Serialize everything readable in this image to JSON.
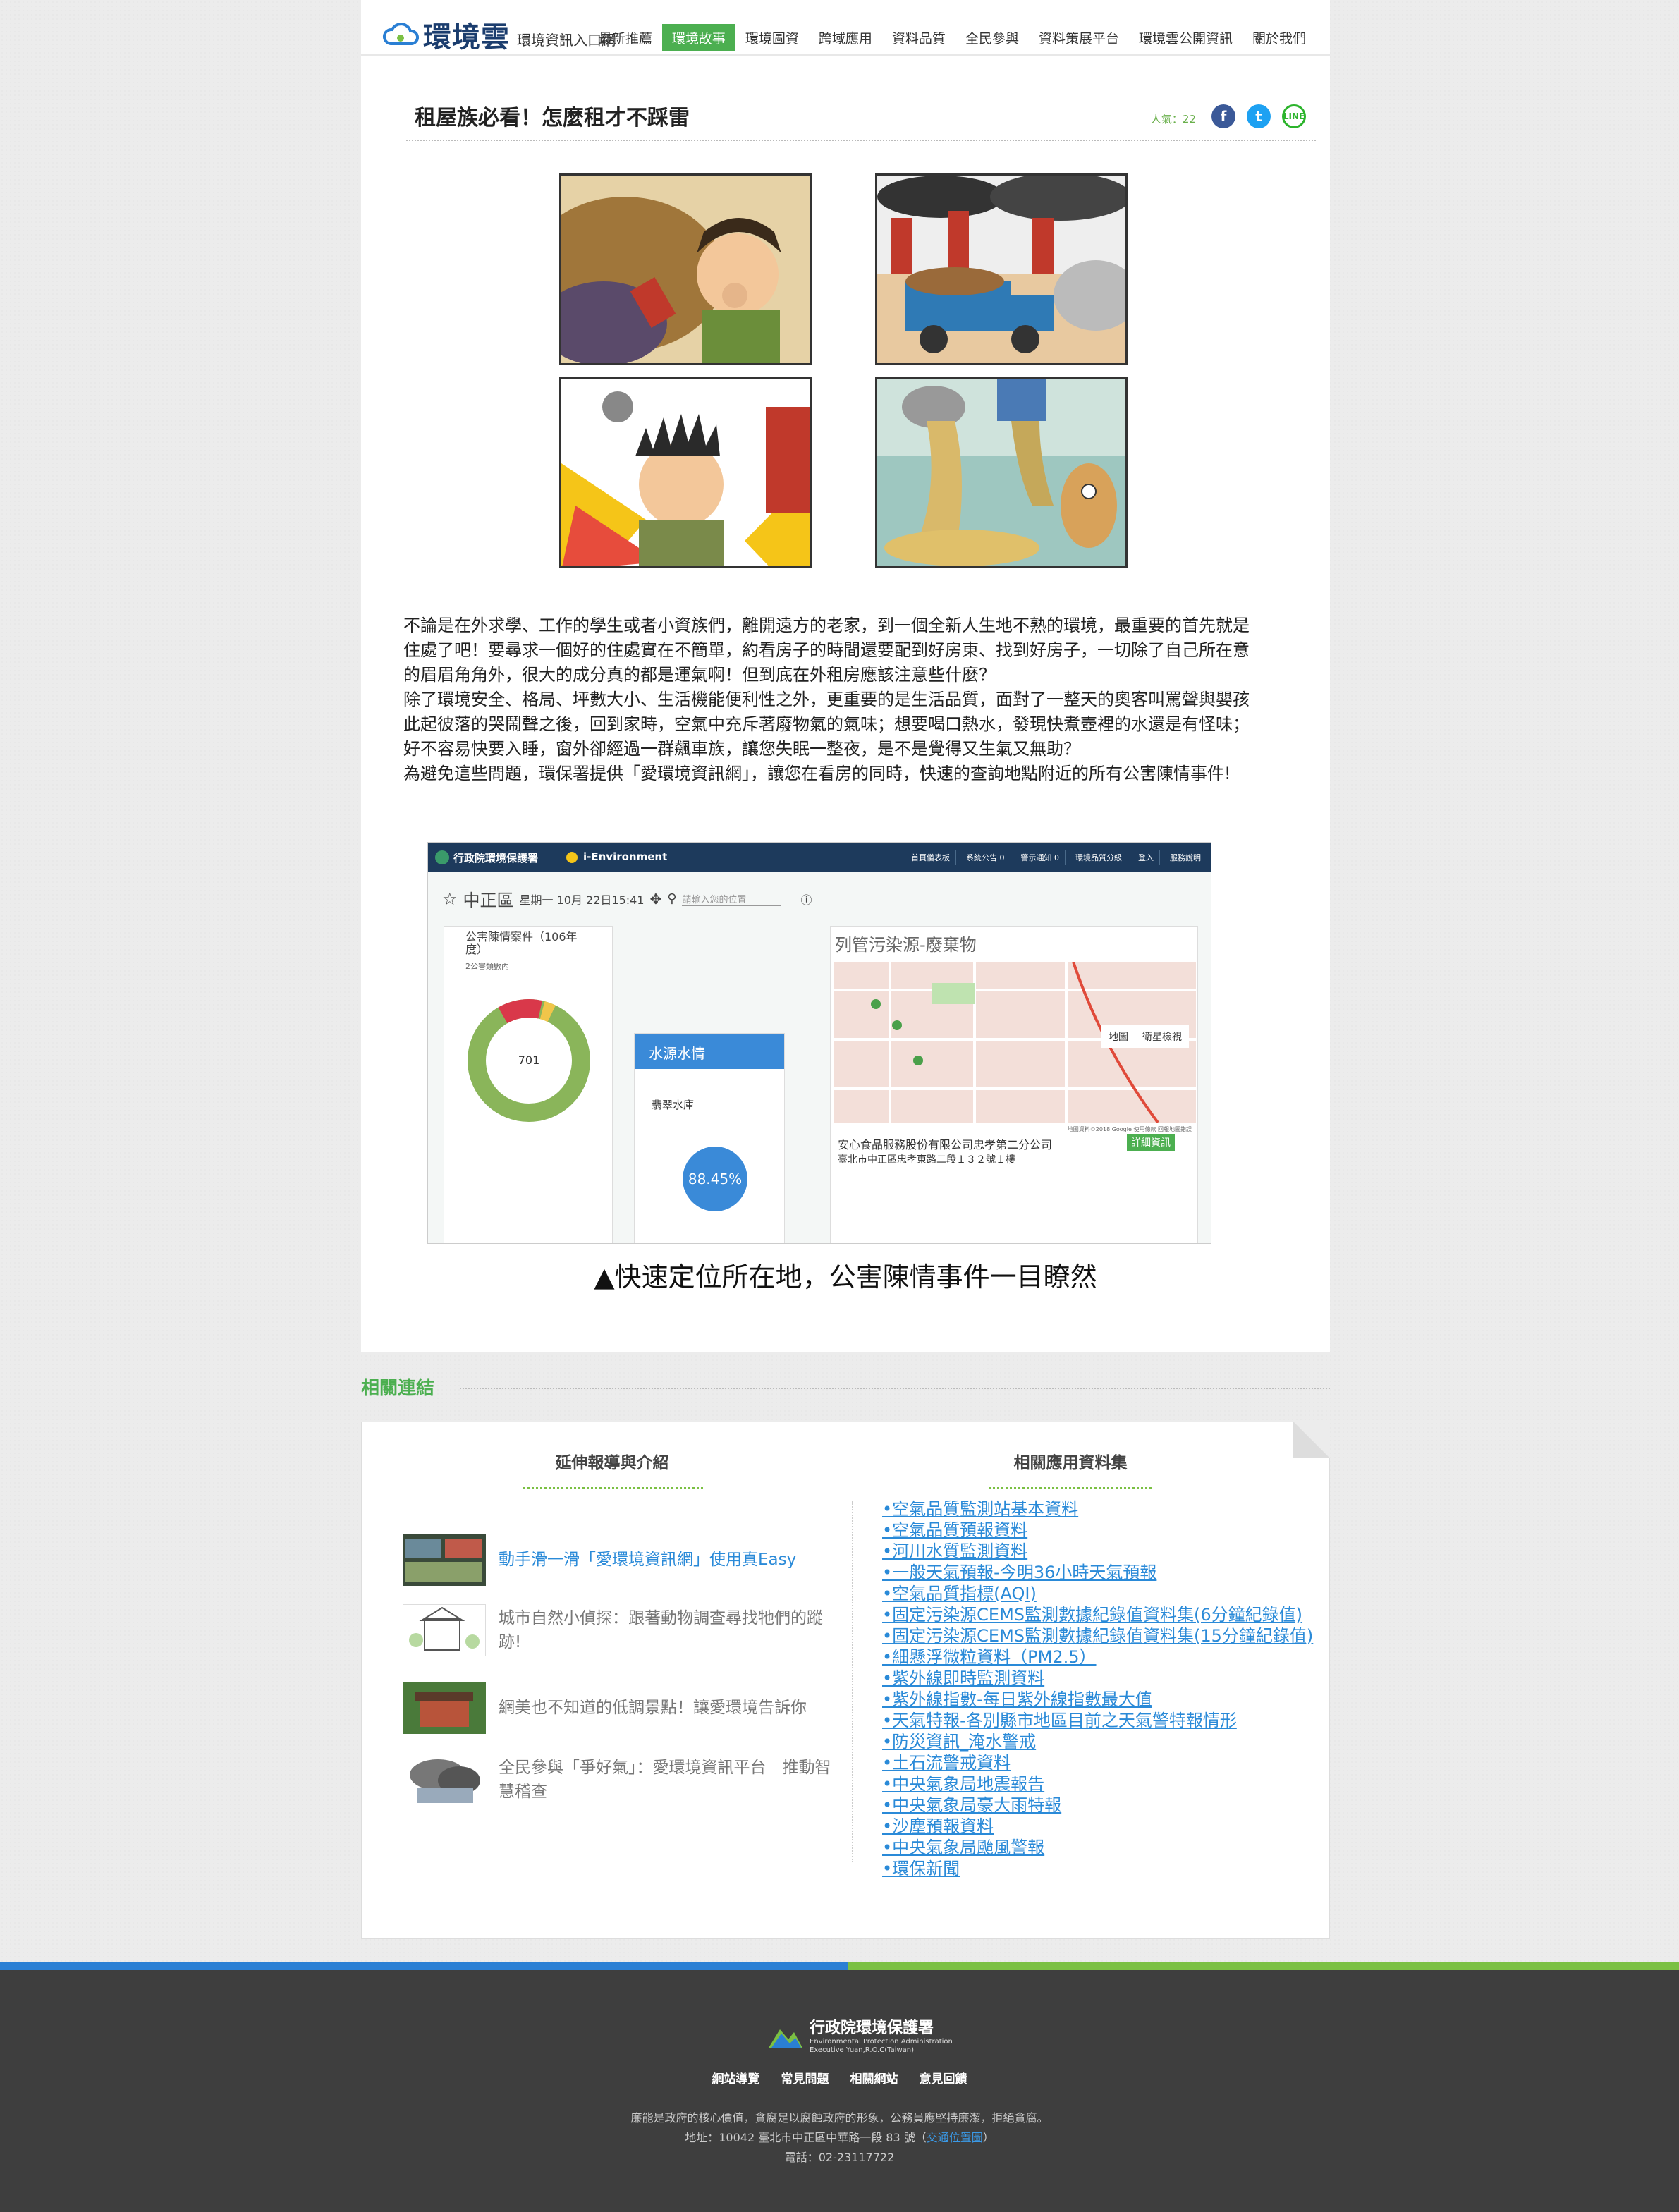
{
  "header": {
    "logo_main": "環境雲",
    "logo_sub": "環境資訊入口網",
    "nav": [
      "最新推薦",
      "環境故事",
      "環境圖資",
      "跨域應用",
      "資料品質",
      "全民參與",
      "資料策展平台",
      "環境雲公開資訊",
      "關於我們"
    ],
    "active_nav": "環境故事"
  },
  "article": {
    "title": "租屋族必看！怎麼租才不踩雷",
    "views": "人氣：22",
    "share": {
      "facebook": "f",
      "twitter": "t",
      "line": "LINE"
    },
    "paragraphs": [
      "不論是在外求學、工作的學生或者小資族們，離開遠方的老家，到一個全新人生地不熟的環境，最重要的首先就是住處了吧！要尋求一個好的住處實在不簡單，約看房子的時間還要配到好房東、找到好房子，一切除了自己所在意的眉眉角角外，很大的成分真的都是運氣啊！但到底在外租房應該注意些什麼？",
      "除了環境安全、格局、坪數大小、生活機能便利性之外，更重要的是生活品質，面對了一整天的奧客叫罵聲與嬰孩此起彼落的哭鬧聲之後，回到家時，空氣中充斥著廢物氣的氣味；想要喝口熱水，發現快煮壺裡的水還是有怪味；好不容易快要入睡，窗外卻經過一群飆車族，讓您失眠一整夜，是不是覺得又生氣又無助？",
      "為避免這些問題，環保署提供「愛環境資訊網」，讓您在看房的同時，快速的查詢地點附近的所有公害陳情事件!"
    ],
    "caption": "▲快速定位所在地，公害陳情事件一目瞭然",
    "screenshot": {
      "brand": "行政院環境保護署",
      "app": "i-Environment",
      "topnav": [
        "首頁儀表板",
        "系統公告 0",
        "警示通知 0",
        "環境品質分級",
        "登入",
        "服務說明"
      ],
      "location": "中正區",
      "datetime": "星期一 10月 22日15:41",
      "search_placeholder": "請輸入您的位置",
      "panel_title": "公害陳情案件（106年度）",
      "panel_sub": "2公害類數內",
      "donut_value": "701",
      "water_title": "水源水情",
      "reservoir": "翡翠水庫",
      "reservoir_value": "88.45%",
      "map_title": "列管污染源-廢棄物",
      "map_btn1": "地圖",
      "map_btn2": "衛星檢視",
      "company": "安心食品服務股份有限公司忠孝第二分公司",
      "company_btn": "詳細資訊",
      "address": "臺北市中正區忠孝東路二段１３２號１樓",
      "map_credit": "地圖資料©2018 Google  使用條款  回報地圖錯誤"
    }
  },
  "related": {
    "title": "相關連結",
    "col1_title": "延伸報導與介紹",
    "col2_title": "相關應用資料集",
    "news": [
      {
        "text": "動手滑一滑「愛環境資訊網」使用真Easy",
        "link": true
      },
      {
        "text": "城市自然小偵探：跟著動物調查尋找牠們的蹤跡!",
        "link": false
      },
      {
        "text": "網美也不知道的低調景點！讓愛環境告訴你",
        "link": false
      },
      {
        "text": "全民參與「爭好氣」：愛環境資訊平台　推動智慧稽查",
        "link": false
      }
    ],
    "datasets": [
      "•空氣品質監測站基本資料",
      "•空氣品質預報資料",
      "•河川水質監測資料",
      "•一般天氣預報-今明36小時天氣預報",
      "•空氣品質指標(AQI)",
      "•固定污染源CEMS監測數據紀錄值資料集(6分鐘紀錄值)",
      "•固定污染源CEMS監測數據紀錄值資料集(15分鐘紀錄值)",
      "•細懸浮微粒資料（PM2.5）",
      "•紫外線即時監測資料",
      "•紫外線指數-每日紫外線指數最大值",
      "•天氣特報-各別縣市地區目前之天氣警特報情形",
      "•防災資訊_淹水警戒",
      "•土石流警戒資料",
      "•中央氣象局地震報告",
      "•中央氣象局豪大雨特報",
      "•沙塵預報資料",
      "•中央氣象局颱風警報",
      "•環保新聞"
    ]
  },
  "footer": {
    "org": "行政院環境保護署",
    "org_en1": "Environmental Protection Administration",
    "org_en2": "Executive Yuan,R.O.C(Taiwan)",
    "links": [
      "網站導覽",
      "常見問題",
      "相關網站",
      "意見回饋"
    ],
    "motto": "廉能是政府的核心價值，貪腐足以腐蝕政府的形象，公務員應堅持廉潔，拒絕貪腐。",
    "address": "地址：10042 臺北市中正區中華路一段 83 號（",
    "traffic": "交通位置圖",
    "address_end": "）",
    "phone": "電話：02-23117722"
  },
  "colors": {
    "accent_green": "#4caf50",
    "link_blue": "#2a8ad8",
    "footer_bg": "#3e3e3e"
  }
}
